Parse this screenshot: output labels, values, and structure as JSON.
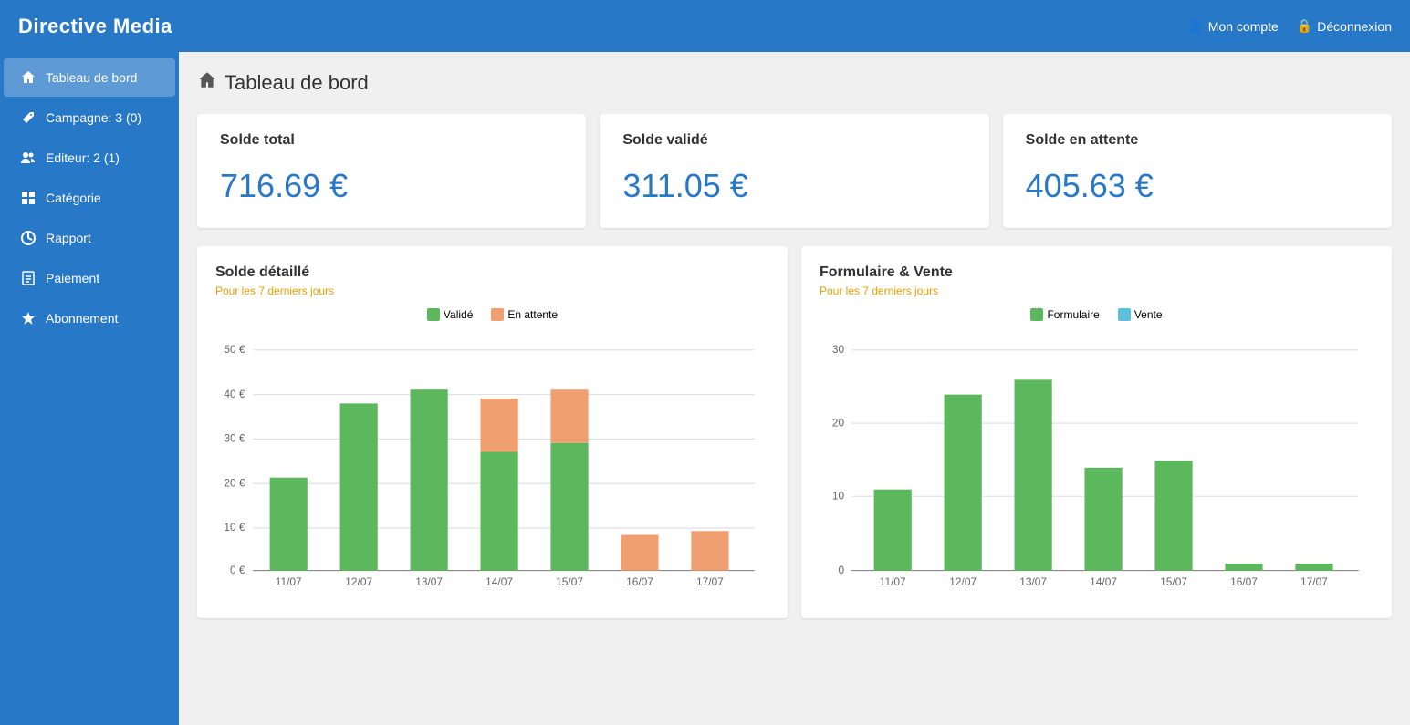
{
  "app": {
    "name": "Directive Media"
  },
  "header": {
    "mon_compte": "Mon compte",
    "deconnexion": "Déconnexion"
  },
  "sidebar": {
    "items": [
      {
        "id": "tableau-de-bord",
        "label": "Tableau de bord",
        "icon": "home",
        "active": true
      },
      {
        "id": "campagne",
        "label": "Campagne: 3 (0)",
        "icon": "tag",
        "active": false
      },
      {
        "id": "editeur",
        "label": "Editeur: 2 (1)",
        "icon": "users",
        "active": false
      },
      {
        "id": "categorie",
        "label": "Catégorie",
        "icon": "grid",
        "active": false
      },
      {
        "id": "rapport",
        "label": "Rapport",
        "icon": "chart",
        "active": false
      },
      {
        "id": "paiement",
        "label": "Paiement",
        "icon": "file",
        "active": false
      },
      {
        "id": "abonnement",
        "label": "Abonnement",
        "icon": "star",
        "active": false
      }
    ]
  },
  "page": {
    "title": "Tableau de bord"
  },
  "balance_cards": [
    {
      "id": "total",
      "title": "Solde total",
      "value": "716.69 €"
    },
    {
      "id": "valide",
      "title": "Solde validé",
      "value": "311.05 €"
    },
    {
      "id": "attente",
      "title": "Solde en attente",
      "value": "405.63 €"
    }
  ],
  "charts": {
    "solde": {
      "title": "Solde détaillé",
      "subtitle": "Pour les 7 derniers jours",
      "legend": [
        {
          "label": "Validé",
          "color": "#5cb85c"
        },
        {
          "label": "En attente",
          "color": "#f0a070"
        }
      ],
      "max_y": 50,
      "y_labels": [
        "50 €",
        "40 €",
        "30 €",
        "20 €",
        "10 €",
        "0 €"
      ],
      "bars": [
        {
          "date": "11/07",
          "valide": 21,
          "attente": 0
        },
        {
          "date": "12/07",
          "valide": 38,
          "attente": 0
        },
        {
          "date": "13/07",
          "valide": 41,
          "attente": 0
        },
        {
          "date": "14/07",
          "valide": 27,
          "attente": 12
        },
        {
          "date": "15/07",
          "valide": 29,
          "attente": 12
        },
        {
          "date": "16/07",
          "valide": 0,
          "attente": 8
        },
        {
          "date": "17/07",
          "valide": 0,
          "attente": 9
        }
      ]
    },
    "formulaire": {
      "title": "Formulaire & Vente",
      "subtitle": "Pour les 7 derniers jours",
      "legend": [
        {
          "label": "Formulaire",
          "color": "#5cb85c"
        },
        {
          "label": "Vente",
          "color": "#5bc0de"
        }
      ],
      "max_y": 30,
      "y_labels": [
        "30",
        "20",
        "10",
        "0"
      ],
      "bars": [
        {
          "date": "11/07",
          "formulaire": 11,
          "vente": 0
        },
        {
          "date": "12/07",
          "formulaire": 24,
          "vente": 0
        },
        {
          "date": "13/07",
          "formulaire": 26,
          "vente": 0
        },
        {
          "date": "14/07",
          "formulaire": 14,
          "vente": 0
        },
        {
          "date": "15/07",
          "formulaire": 15,
          "vente": 0
        },
        {
          "date": "16/07",
          "formulaire": 1,
          "vente": 0
        },
        {
          "date": "17/07",
          "formulaire": 1,
          "vente": 0
        }
      ]
    }
  },
  "colors": {
    "brand_blue": "#2878c8",
    "green": "#5cb85c",
    "orange": "#f0a070",
    "light_blue": "#5bc0de",
    "accent_orange": "#e8a000"
  }
}
